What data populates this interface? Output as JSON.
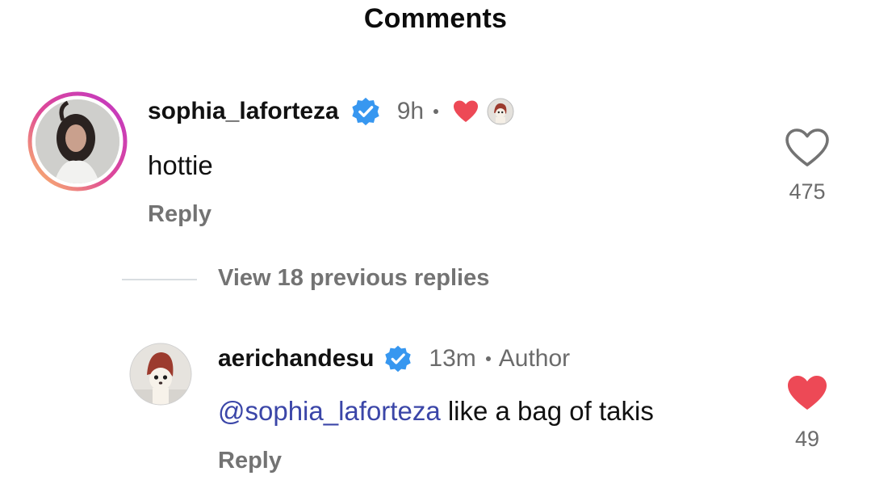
{
  "header": {
    "title": "Comments"
  },
  "comments": [
    {
      "username": "sophia_laforteza",
      "verified": true,
      "time": "9h",
      "liked_by_author": true,
      "text": "hottie",
      "reply_label": "Reply",
      "like_count": "475",
      "liked": false,
      "avatar_icon": "user-photo-avatar"
    }
  ],
  "view_replies": {
    "label": "View 18 previous replies"
  },
  "replies": [
    {
      "username": "aerichandesu",
      "verified": true,
      "time": "13m",
      "author_label": "Author",
      "mention": "@sophia_laforteza",
      "text": " like a bag of takis",
      "reply_label": "Reply",
      "like_count": "49",
      "liked": true,
      "avatar_icon": "dog-photo-avatar"
    }
  ],
  "colors": {
    "verified_blue": "#3797f0",
    "heart_red": "#ed4956",
    "mention": "#3b46a8",
    "muted_text": "#737373"
  }
}
